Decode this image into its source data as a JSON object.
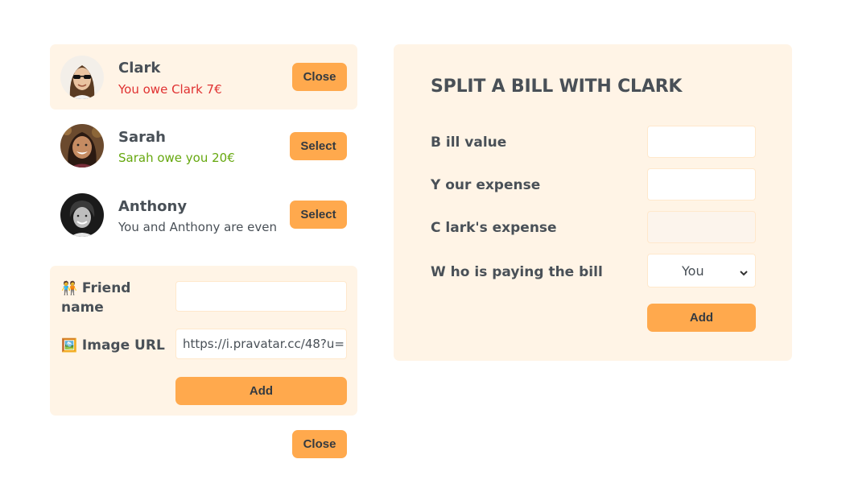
{
  "friends": [
    {
      "name": "Clark",
      "status": "You owe Clark 7€",
      "button": "Close"
    },
    {
      "name": "Sarah",
      "status": "Sarah owe you 20€",
      "button": "Select"
    },
    {
      "name": "Anthony",
      "status": "You and Anthony are even",
      "button": "Select"
    }
  ],
  "add_friend_form": {
    "name_emoji": "🧑‍🤝‍🧑",
    "name_label": "Friend name",
    "name_value": "",
    "image_emoji": "🖼️",
    "image_label": "Image URL",
    "image_value": "https://i.pravatar.cc/48?u=",
    "add_label": "Add"
  },
  "close_label": "Close",
  "split_form": {
    "title": "SPLIT A BILL WITH CLARK",
    "bill_label": "B ill value",
    "bill_value": "",
    "expense_label": "Y our expense",
    "expense_value": "",
    "friend_expense_label": "C lark's expense",
    "friend_expense_value": "",
    "payer_label": "W ho is paying the bill",
    "payer_value": "You",
    "add_label": "Add"
  },
  "colors": {
    "accent": "#ffa94d",
    "panel": "#fff4e6",
    "owe_red": "#e03131",
    "owed_green": "#66a80f"
  }
}
